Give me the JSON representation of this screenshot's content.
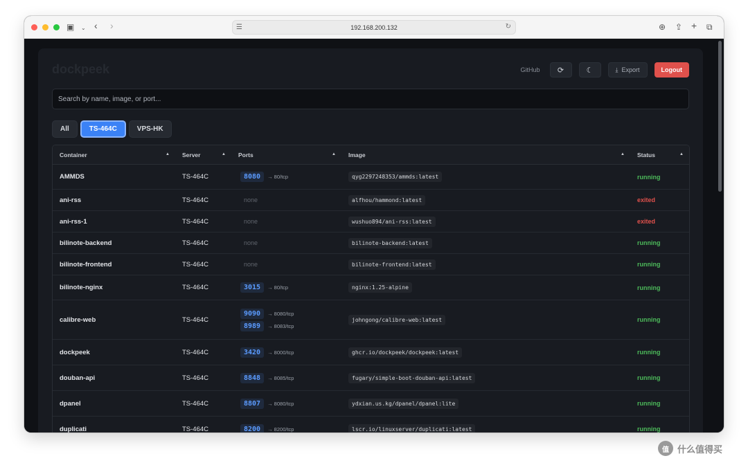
{
  "browser": {
    "url": "192.168.200.132"
  },
  "app": {
    "brand": "dockpeek",
    "github_label": "GitHub",
    "export_label": "Export",
    "logout_label": "Logout",
    "search_placeholder": "Search by name, image, or port..."
  },
  "filters": [
    {
      "label": "All",
      "active": false
    },
    {
      "label": "TS-464C",
      "active": true
    },
    {
      "label": "VPS-HK",
      "active": false
    }
  ],
  "table": {
    "headers": [
      "Container",
      "Server",
      "Ports",
      "Image",
      "Status"
    ],
    "none_label": "none",
    "rows": [
      {
        "name": "AMMDS",
        "server": "TS-464C",
        "ports": [
          {
            "host": "8080",
            "container": "→ 80/tcp"
          }
        ],
        "image": "qyg2297248353/ammds:latest",
        "status": "running"
      },
      {
        "name": "ani-rss",
        "server": "TS-464C",
        "ports": [],
        "image": "alfhou/hammond:latest",
        "status": "exited"
      },
      {
        "name": "ani-rss-1",
        "server": "TS-464C",
        "ports": [],
        "image": "wushuo894/ani-rss:latest",
        "status": "exited"
      },
      {
        "name": "bilinote-backend",
        "server": "TS-464C",
        "ports": [],
        "image": "bilinote-backend:latest",
        "status": "running"
      },
      {
        "name": "bilinote-frontend",
        "server": "TS-464C",
        "ports": [],
        "image": "bilinote-frontend:latest",
        "status": "running"
      },
      {
        "name": "bilinote-nginx",
        "server": "TS-464C",
        "ports": [
          {
            "host": "3015",
            "container": "→ 80/tcp"
          }
        ],
        "image": "nginx:1.25-alpine",
        "status": "running"
      },
      {
        "name": "calibre-web",
        "server": "TS-464C",
        "ports": [
          {
            "host": "9090",
            "container": "→ 8080/tcp"
          },
          {
            "host": "8989",
            "container": "→ 8083/tcp"
          }
        ],
        "image": "johngong/calibre-web:latest",
        "status": "running"
      },
      {
        "name": "dockpeek",
        "server": "TS-464C",
        "ports": [
          {
            "host": "3420",
            "container": "→ 8000/tcp"
          }
        ],
        "image": "ghcr.io/dockpeek/dockpeek:latest",
        "status": "running"
      },
      {
        "name": "douban-api",
        "server": "TS-464C",
        "ports": [
          {
            "host": "8848",
            "container": "→ 8085/tcp"
          }
        ],
        "image": "fugary/simple-boot-douban-api:latest",
        "status": "running"
      },
      {
        "name": "dpanel",
        "server": "TS-464C",
        "ports": [
          {
            "host": "8807",
            "container": "→ 8080/tcp"
          }
        ],
        "image": "ydxian.us.kg/dpanel/dpanel:lite",
        "status": "running"
      },
      {
        "name": "duplicati",
        "server": "TS-464C",
        "ports": [
          {
            "host": "8200",
            "container": "→ 8200/tcp"
          }
        ],
        "image": "lscr.io/linuxserver/duplicati:latest",
        "status": "running"
      }
    ]
  },
  "watermark": {
    "icon_text": "值",
    "text": "什么值得买"
  }
}
